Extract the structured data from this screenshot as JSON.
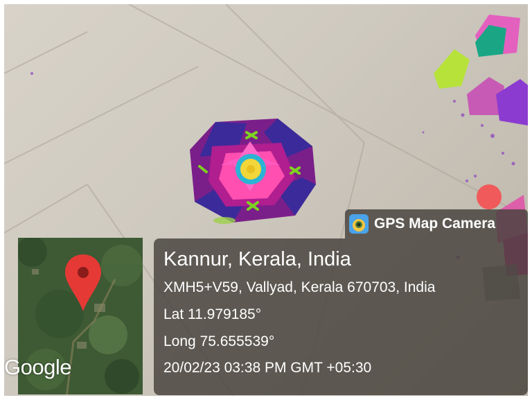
{
  "app_name": "GPS Map Camera",
  "map": {
    "logo_text": "Google",
    "pin_icon": "location-pin-icon",
    "pin_color": "#e53935"
  },
  "location": {
    "place": "Kannur, Kerala, India",
    "address": "XMH5+V59, Vallyad, Kerala 670703, India",
    "latitude": "Lat 11.979185°",
    "longitude": "Long 75.655539°",
    "datetime": "20/02/23 03:38 PM GMT +05:30"
  },
  "colors": {
    "panel_background": "#46423c",
    "text": "#ffffff"
  }
}
